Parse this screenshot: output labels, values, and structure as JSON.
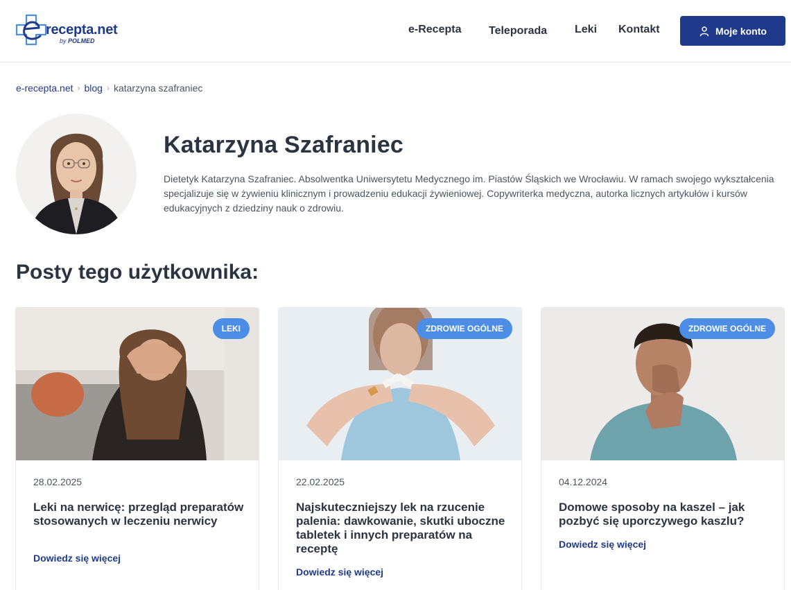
{
  "header": {
    "logo_text": "recepta.net",
    "logo_by": "by",
    "logo_brand": "POLMED",
    "nav": [
      "e-Recepta",
      "Teleporada",
      "Leki",
      "Kontakt"
    ],
    "account_label": "Moje konto"
  },
  "breadcrumb": {
    "home": "e-recepta.net",
    "section": "blog",
    "current": "katarzyna szafraniec"
  },
  "author": {
    "name": "Katarzyna Szafraniec",
    "bio": "Dietetyk Katarzyna Szafraniec. Absolwentka Uniwersytetu Medycznego im. Piastów Śląskich we Wrocławiu. W ramach swojego wykształcenia specjalizuje się w żywieniu klinicznym i prowadzeniu edukacji żywieniowej. Copywriterka medyczna, autorka licznych artykułów i kursów edukacyjnych z dziedziny nauk o zdrowiu."
  },
  "posts_heading": "Posty tego użytkownika:",
  "posts": [
    {
      "category": "LEKI",
      "date": "28.02.2025",
      "title": "Leki na nerwicę: przegląd preparatów stosowanych w leczeniu nerwicy",
      "link": "Dowiedz się więcej"
    },
    {
      "category": "ZDROWIE OGÓLNE",
      "date": "22.02.2025",
      "title": "Najskuteczniejszy lek na rzucenie palenia: dawkowanie, skutki uboczne tabletek i innych preparatów na receptę",
      "link": "Dowiedz się więcej"
    },
    {
      "category": "ZDROWIE OGÓLNE",
      "date": "04.12.2024",
      "title": "Domowe sposoby na kaszel – jak pozbyć się uporczywego kaszlu?",
      "link": "Dowiedz się więcej"
    }
  ],
  "colors": {
    "primary": "#1f3a8a",
    "badge": "#4c8de6",
    "text": "#2b3441"
  },
  "icons": {
    "account": "user-icon",
    "breadcrumb_separator": "chevron-right-icon"
  }
}
